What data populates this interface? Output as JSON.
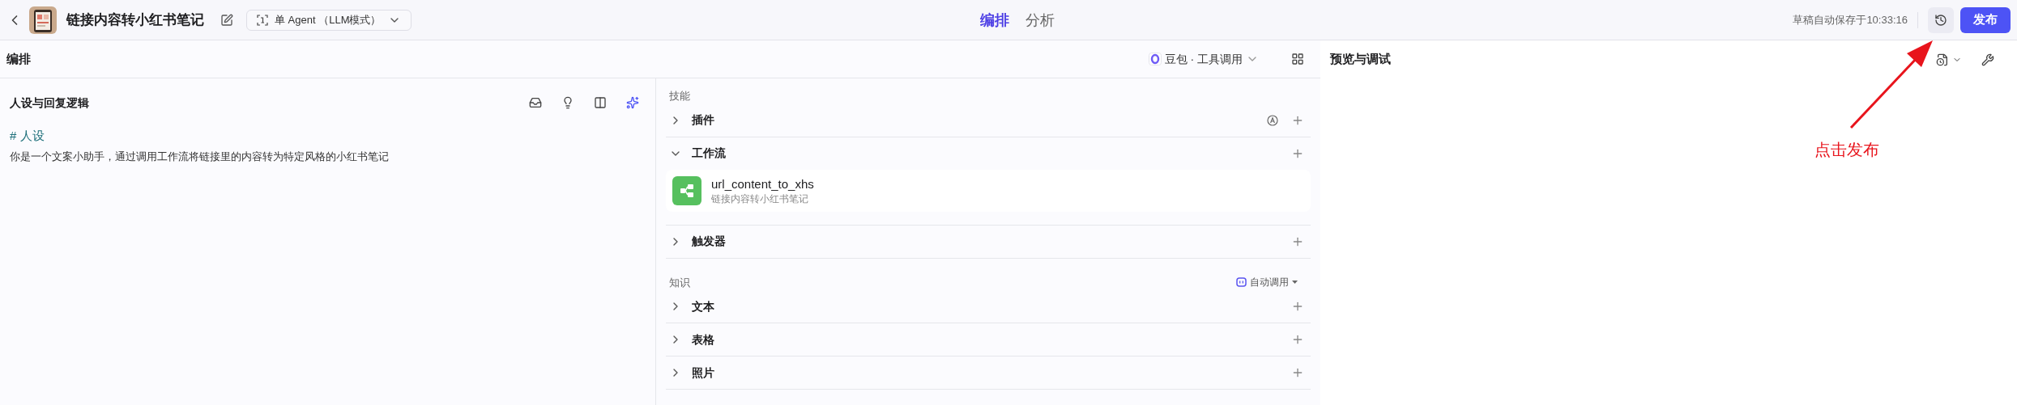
{
  "header": {
    "title": "链接内容转小红书笔记",
    "mode": "单 Agent （LLM模式）",
    "tabs": [
      {
        "label": "编排",
        "selected": true
      },
      {
        "label": "分析",
        "selected": false
      }
    ],
    "autosave": "草稿自动保存于10:33:16",
    "publish": "发布"
  },
  "arrange": {
    "title": "编排",
    "model": "豆包 · 工具调用"
  },
  "persona": {
    "title": "人设与回复逻辑",
    "heading": "# 人设",
    "text": "你是一个文案小助手，通过调用工作流将链接里的内容转为特定风格的小红书笔记"
  },
  "skills": {
    "label": "技能",
    "sections": [
      {
        "kind": "plugin",
        "title": "插件",
        "expanded": false
      },
      {
        "kind": "workflow",
        "title": "工作流",
        "expanded": true,
        "items": [
          {
            "name": "url_content_to_xhs",
            "description": "链接内容转小红书笔记"
          }
        ]
      },
      {
        "kind": "plain",
        "title": "触发器",
        "expanded": false
      }
    ]
  },
  "knowledge": {
    "label": "知识",
    "mode": "自动调用",
    "sections": [
      {
        "kind": "plain",
        "title": "文本",
        "expanded": false
      },
      {
        "kind": "plain",
        "title": "表格",
        "expanded": false
      },
      {
        "kind": "plain",
        "title": "照片",
        "expanded": false
      }
    ]
  },
  "preview": {
    "title": "预览与调试"
  },
  "annotation": {
    "text": "点击发布"
  }
}
